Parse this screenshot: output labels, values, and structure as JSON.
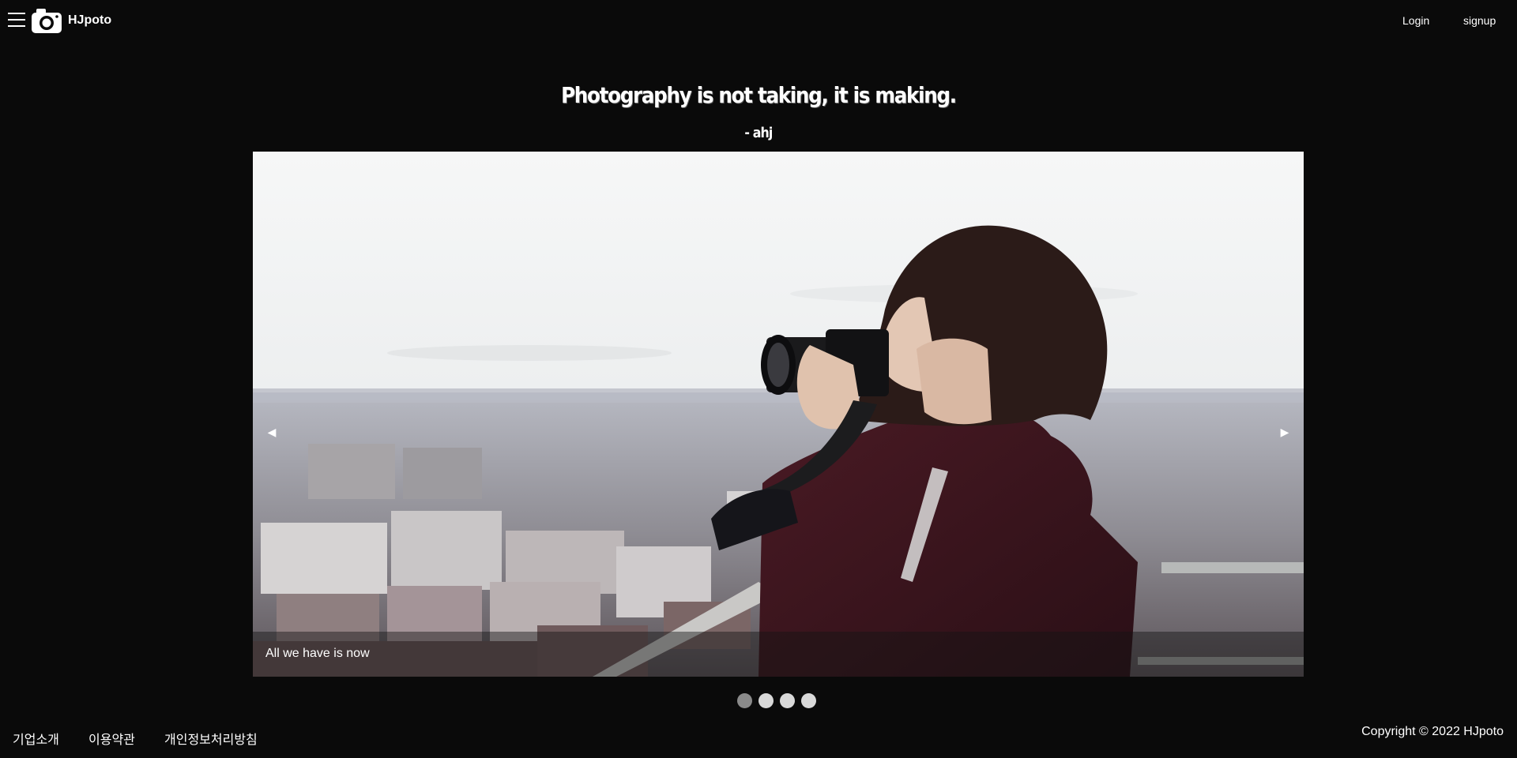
{
  "header": {
    "brand": "HJpoto",
    "menu_icon": "hamburger-menu-icon",
    "logo_icon": "camera-icon",
    "login_label": "Login",
    "signup_label": "signup"
  },
  "hero": {
    "quote": "Photography is not taking, it is making.",
    "author": "- ahj"
  },
  "carousel": {
    "caption": "All we have is now",
    "prev_icon": "triangle-left-icon",
    "next_icon": "triangle-right-icon",
    "prev_glyph": "◀",
    "next_glyph": "▶",
    "slide_count": 4,
    "active_index": 0
  },
  "footer": {
    "links": [
      "기업소개",
      "이용약관",
      "개인정보처리방침"
    ],
    "copyright": "Copyright © 2022 HJpoto"
  },
  "colors": {
    "background": "#0a0a0a",
    "text": "#ffffff",
    "dot": "#d9d9d9",
    "dot_active": "#8a8a8a"
  }
}
